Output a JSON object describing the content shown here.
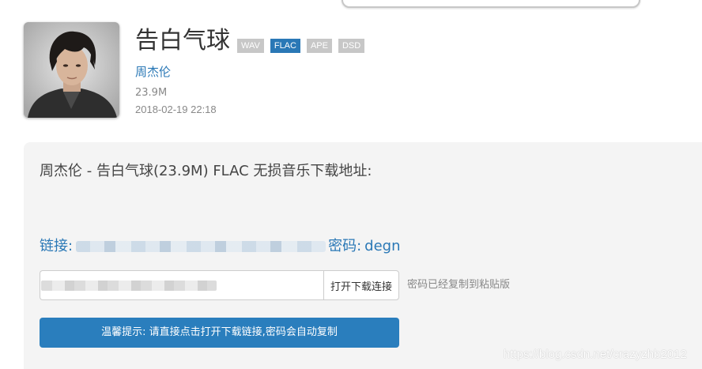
{
  "song": {
    "title": "告白气球",
    "formats": [
      {
        "label": "WAV",
        "active": false
      },
      {
        "label": "FLAC",
        "active": true
      },
      {
        "label": "APE",
        "active": false
      },
      {
        "label": "DSD",
        "active": false
      }
    ],
    "artist": "周杰伦",
    "size": "23.9M",
    "date": "2018-02-19 22:18"
  },
  "download": {
    "heading": "周杰伦 - 告白气球(23.9M) FLAC 无损音乐下载地址:",
    "link_label": "链接:",
    "password_label": "密码:",
    "password": "degn",
    "open_button": "打开下载连接",
    "copy_status": "密码已经复制到粘贴版",
    "tip": "温馨提示: 请直接点击打开下载链接,密码会自动复制"
  },
  "watermark": "https://blog.csdn.net/crazyzhb2012",
  "colors": {
    "accent": "#2a78b6",
    "badge_inactive": "#c7c7c7",
    "panel_bg": "#f4f4f4"
  }
}
